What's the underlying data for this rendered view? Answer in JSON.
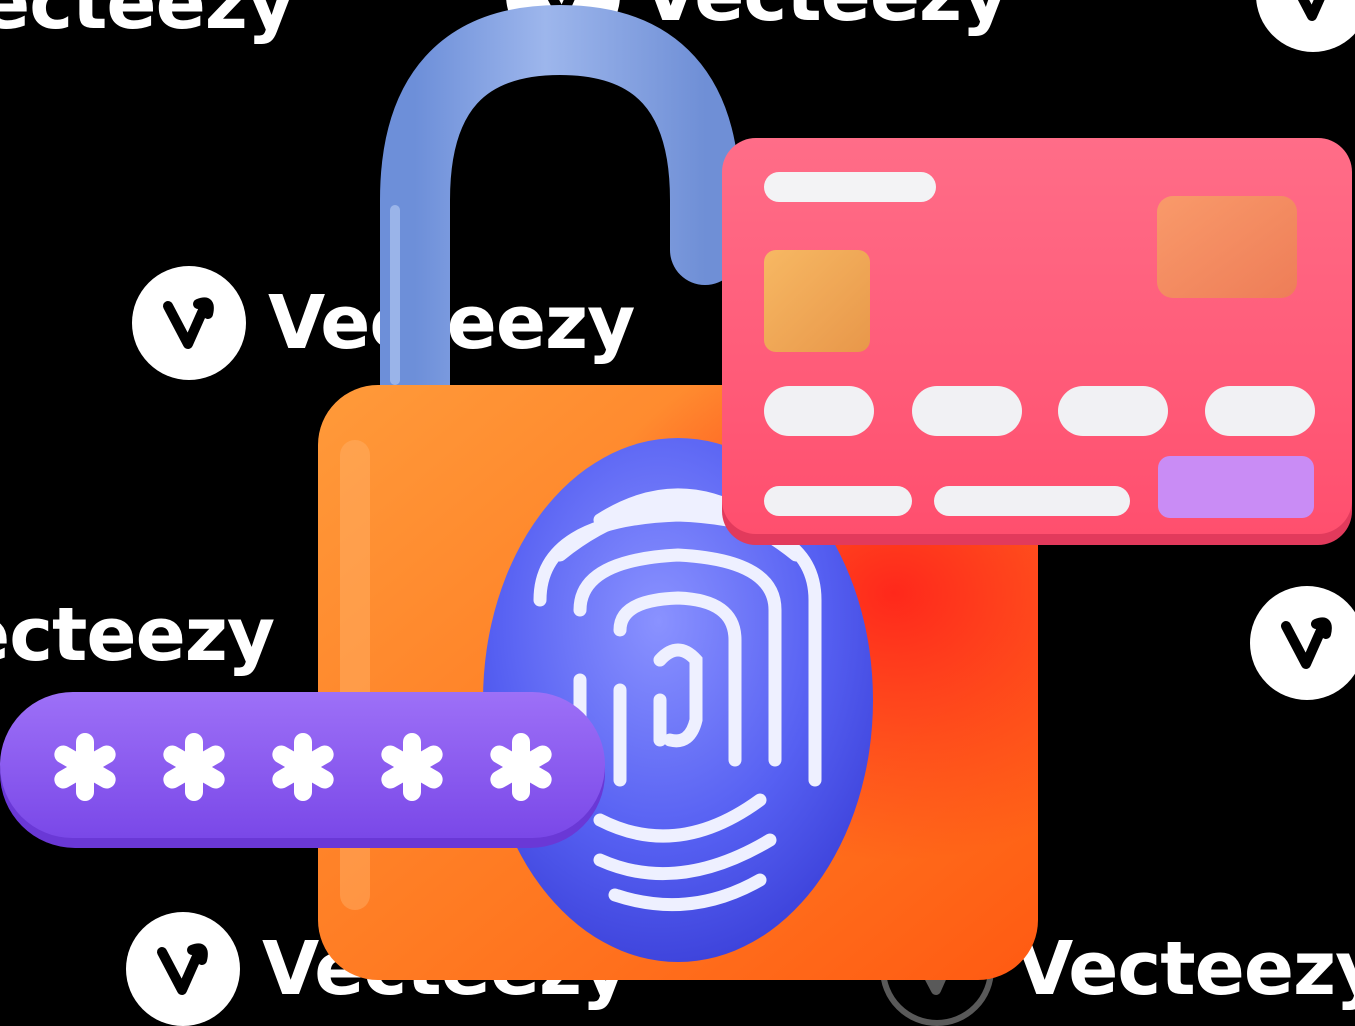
{
  "illustration": {
    "subject": "3D padlock with fingerprint, credit card and password field",
    "colors": {
      "shackle": "#7f9bd8",
      "lock_body_top": "#ff8a2a",
      "lock_body_bottom": "#ff5a10",
      "fingerprint_pad": "#5a62f0",
      "card": "#ff6682",
      "card_chip_left": "#f0a852",
      "card_chip_right": "#f28a62",
      "card_tag": "#c98cf5",
      "password_pill": "#8a5cf0",
      "password_mask": "#ffffff"
    },
    "password_mask": "*****"
  },
  "watermarks": {
    "brand": "Vecteezy",
    "partial_left": "ecteezy",
    "partial_top": "Vecteezy"
  }
}
